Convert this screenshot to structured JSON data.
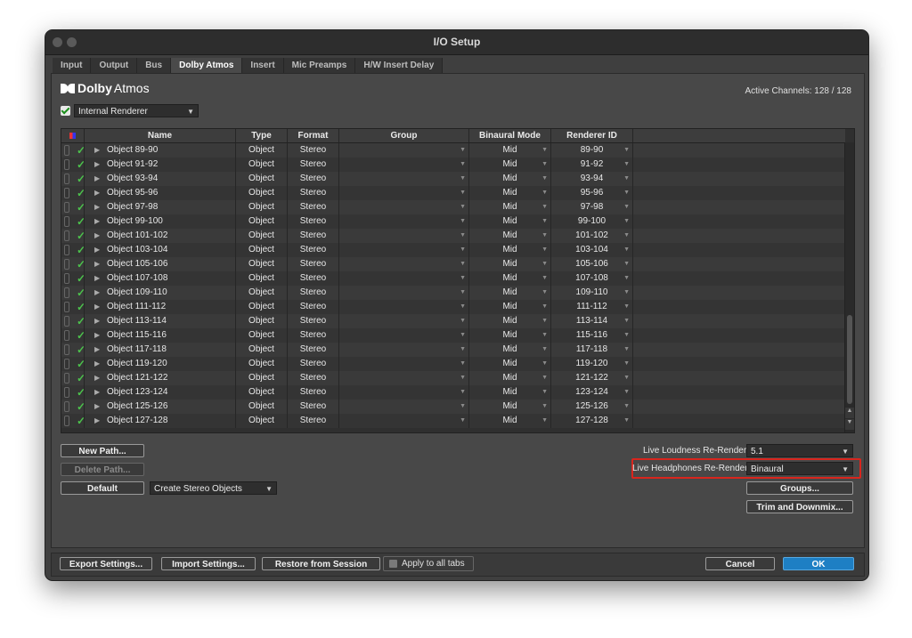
{
  "window": {
    "title": "I/O Setup"
  },
  "tabs": [
    "Input",
    "Output",
    "Bus",
    "Dolby Atmos",
    "Insert",
    "Mic Preamps",
    "H/W Insert Delay"
  ],
  "active_tab": "Dolby Atmos",
  "header": {
    "logo_bold": "Dolby",
    "logo_light": "Atmos",
    "active_channels": "Active Channels: 128 / 128"
  },
  "renderer": {
    "label": "Internal Renderer",
    "checked": true
  },
  "table": {
    "columns": [
      "Name",
      "Type",
      "Format",
      "Group",
      "Binaural Mode",
      "Renderer ID"
    ],
    "rows": [
      {
        "name": "Object 89-90",
        "type": "Object",
        "format": "Stereo",
        "group": "",
        "binaural": "Mid",
        "renderer_id": "89-90"
      },
      {
        "name": "Object 91-92",
        "type": "Object",
        "format": "Stereo",
        "group": "",
        "binaural": "Mid",
        "renderer_id": "91-92"
      },
      {
        "name": "Object 93-94",
        "type": "Object",
        "format": "Stereo",
        "group": "",
        "binaural": "Mid",
        "renderer_id": "93-94"
      },
      {
        "name": "Object 95-96",
        "type": "Object",
        "format": "Stereo",
        "group": "",
        "binaural": "Mid",
        "renderer_id": "95-96"
      },
      {
        "name": "Object 97-98",
        "type": "Object",
        "format": "Stereo",
        "group": "",
        "binaural": "Mid",
        "renderer_id": "97-98"
      },
      {
        "name": "Object 99-100",
        "type": "Object",
        "format": "Stereo",
        "group": "",
        "binaural": "Mid",
        "renderer_id": "99-100"
      },
      {
        "name": "Object 101-102",
        "type": "Object",
        "format": "Stereo",
        "group": "",
        "binaural": "Mid",
        "renderer_id": "101-102"
      },
      {
        "name": "Object 103-104",
        "type": "Object",
        "format": "Stereo",
        "group": "",
        "binaural": "Mid",
        "renderer_id": "103-104"
      },
      {
        "name": "Object 105-106",
        "type": "Object",
        "format": "Stereo",
        "group": "",
        "binaural": "Mid",
        "renderer_id": "105-106"
      },
      {
        "name": "Object 107-108",
        "type": "Object",
        "format": "Stereo",
        "group": "",
        "binaural": "Mid",
        "renderer_id": "107-108"
      },
      {
        "name": "Object 109-110",
        "type": "Object",
        "format": "Stereo",
        "group": "",
        "binaural": "Mid",
        "renderer_id": "109-110"
      },
      {
        "name": "Object 111-112",
        "type": "Object",
        "format": "Stereo",
        "group": "",
        "binaural": "Mid",
        "renderer_id": "111-112"
      },
      {
        "name": "Object 113-114",
        "type": "Object",
        "format": "Stereo",
        "group": "",
        "binaural": "Mid",
        "renderer_id": "113-114"
      },
      {
        "name": "Object 115-116",
        "type": "Object",
        "format": "Stereo",
        "group": "",
        "binaural": "Mid",
        "renderer_id": "115-116"
      },
      {
        "name": "Object 117-118",
        "type": "Object",
        "format": "Stereo",
        "group": "",
        "binaural": "Mid",
        "renderer_id": "117-118"
      },
      {
        "name": "Object 119-120",
        "type": "Object",
        "format": "Stereo",
        "group": "",
        "binaural": "Mid",
        "renderer_id": "119-120"
      },
      {
        "name": "Object 121-122",
        "type": "Object",
        "format": "Stereo",
        "group": "",
        "binaural": "Mid",
        "renderer_id": "121-122"
      },
      {
        "name": "Object 123-124",
        "type": "Object",
        "format": "Stereo",
        "group": "",
        "binaural": "Mid",
        "renderer_id": "123-124"
      },
      {
        "name": "Object 125-126",
        "type": "Object",
        "format": "Stereo",
        "group": "",
        "binaural": "Mid",
        "renderer_id": "125-126"
      },
      {
        "name": "Object 127-128",
        "type": "Object",
        "format": "Stereo",
        "group": "",
        "binaural": "Mid",
        "renderer_id": "127-128"
      }
    ]
  },
  "buttons": {
    "new_path": "New Path...",
    "delete_path": "Delete Path...",
    "default": "Default",
    "create_stereo": "Create Stereo Objects",
    "groups": "Groups...",
    "trim_downmix": "Trim and Downmix...",
    "export": "Export Settings...",
    "import": "Import Settings...",
    "restore": "Restore from Session",
    "apply_all": "Apply to all tabs",
    "cancel": "Cancel",
    "ok": "OK"
  },
  "rerender": {
    "loudness_label": "Live Loudness Re-Render:",
    "loudness_value": "5.1",
    "headphones_label": "Live Headphones Re-Render:",
    "headphones_value": "Binaural"
  },
  "colors": {
    "accent_ok": "#1e7fc4",
    "highlight_box": "#d9251d",
    "check_green": "#4cc24c"
  }
}
